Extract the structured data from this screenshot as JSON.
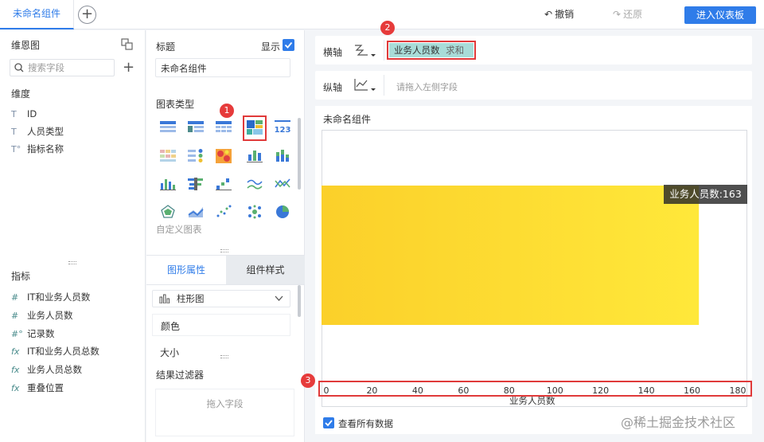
{
  "topbar": {
    "tab_label": "未命名组件",
    "add_tab": "+",
    "undo_label": "撤销",
    "redo_label": "还原",
    "enter_label": "进入仪表板"
  },
  "left": {
    "dimension_section": "维恩图",
    "search_placeholder": "搜索字段",
    "dimension_title": "维度",
    "dimensions": [
      {
        "label": "ID",
        "icon": "T"
      },
      {
        "label": "人员类型",
        "icon": "T"
      },
      {
        "label": "指标名称",
        "icon": "T°"
      }
    ],
    "measure_title": "指标",
    "measures": [
      {
        "label": "IT和业务人员数",
        "icon": "#"
      },
      {
        "label": "业务人员数",
        "icon": "#"
      },
      {
        "label": "记录数",
        "icon": "#°"
      },
      {
        "label": "IT和业务人员总数",
        "icon": "fx"
      },
      {
        "label": "业务人员总数",
        "icon": "fx"
      },
      {
        "label": "重叠位置",
        "icon": "fx"
      }
    ]
  },
  "middle": {
    "title_label": "标题",
    "show_label": "显示",
    "title_value": "未命名组件",
    "chart_type_label": "图表类型",
    "custom_chart_label": "自定义图表",
    "tab_graph": "图形属性",
    "tab_style": "组件样式",
    "chart_select": "柱形图",
    "color_label": "颜色",
    "size_label": "大小",
    "filter_label": "结果过滤器",
    "filter_drop": "拖入字段"
  },
  "axes": {
    "x_label": "横轴",
    "x_field": "业务人员数",
    "x_agg": "求和",
    "y_label": "纵轴",
    "y_placeholder": "请拖入左侧字段"
  },
  "chart": {
    "title": "未命名组件",
    "tooltip": "业务人员数:163",
    "view_all_label": "查看所有数据"
  },
  "annotations": [
    "1",
    "2",
    "3"
  ],
  "watermark": "@稀土掘金技术社区",
  "colors": {
    "accent": "#2f7ce9",
    "bar": "#fdd835",
    "highlight": "#e03a3a"
  },
  "chart_data": {
    "type": "bar",
    "orientation": "horizontal",
    "categories": [
      ""
    ],
    "series": [
      {
        "name": "业务人员数",
        "values": [
          163
        ]
      }
    ],
    "xlabel": "业务人员数",
    "xlim": [
      0,
      180
    ],
    "xticks": [
      0,
      20,
      40,
      60,
      80,
      100,
      120,
      140,
      160,
      180
    ],
    "grid": false
  }
}
